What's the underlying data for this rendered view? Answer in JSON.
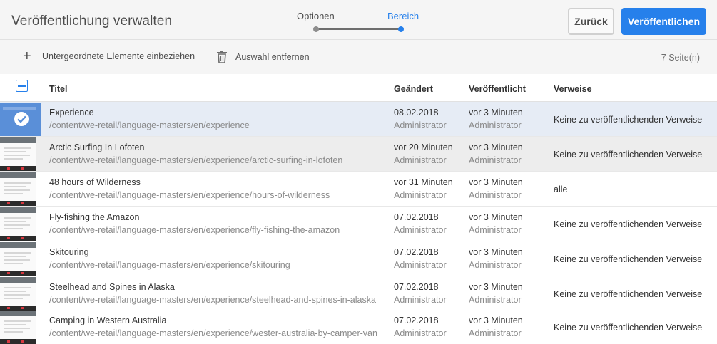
{
  "header": {
    "title": "Veröffentlichung verwalten",
    "steps": [
      "Optionen",
      "Bereich"
    ],
    "back_label": "Zurück",
    "publish_label": "Veröffentlichen"
  },
  "actionbar": {
    "include_children_label": "Untergeordnete Elemente einbeziehen",
    "remove_selection_label": "Auswahl entfernen",
    "page_count": "7 Seite(n)"
  },
  "table": {
    "columns": [
      "Titel",
      "Geändert",
      "Veröffentlicht",
      "Verweise"
    ],
    "rows": [
      {
        "title": "Experience",
        "path": "/content/we-retail/language-masters/en/experience",
        "modified": "08.02.2018",
        "modified_by": "Administrator",
        "published": "vor 3 Minuten",
        "published_by": "Administrator",
        "references": "Keine zu veröffentlichenden Verweise",
        "selected": true
      },
      {
        "title": "Arctic Surfing In Lofoten",
        "path": "/content/we-retail/language-masters/en/experience/arctic-surfing-in-lofoten",
        "modified": "vor 20 Minuten",
        "modified_by": "Administrator",
        "published": "vor 3 Minuten",
        "published_by": "Administrator",
        "references": "Keine zu veröffentlichenden Verweise",
        "selected": false
      },
      {
        "title": "48 hours of Wilderness",
        "path": "/content/we-retail/language-masters/en/experience/hours-of-wilderness",
        "modified": "vor 31 Minuten",
        "modified_by": "Administrator",
        "published": "vor 3 Minuten",
        "published_by": "Administrator",
        "references": "alle",
        "selected": false
      },
      {
        "title": "Fly-fishing the Amazon",
        "path": "/content/we-retail/language-masters/en/experience/fly-fishing-the-amazon",
        "modified": "07.02.2018",
        "modified_by": "Administrator",
        "published": "vor 3 Minuten",
        "published_by": "Administrator",
        "references": "Keine zu veröffentlichenden Verweise",
        "selected": false
      },
      {
        "title": "Skitouring",
        "path": "/content/we-retail/language-masters/en/experience/skitouring",
        "modified": "07.02.2018",
        "modified_by": "Administrator",
        "published": "vor 3 Minuten",
        "published_by": "Administrator",
        "references": "Keine zu veröffentlichenden Verweise",
        "selected": false
      },
      {
        "title": "Steelhead and Spines in Alaska",
        "path": "/content/we-retail/language-masters/en/experience/steelhead-and-spines-in-alaska",
        "modified": "07.02.2018",
        "modified_by": "Administrator",
        "published": "vor 3 Minuten",
        "published_by": "Administrator",
        "references": "Keine zu veröffentlichenden Verweise",
        "selected": false
      },
      {
        "title": "Camping in Western Australia",
        "path": "/content/we-retail/language-masters/en/experience/wester-australia-by-camper-van",
        "modified": "07.02.2018",
        "modified_by": "Administrator",
        "published": "vor 3 Minuten",
        "published_by": "Administrator",
        "references": "Keine zu veröffentlichenden Verweise",
        "selected": false
      }
    ]
  },
  "colors": {
    "accent": "#2680eb",
    "selected_row": "#e6ecf5",
    "hover_row": "#ededed"
  }
}
